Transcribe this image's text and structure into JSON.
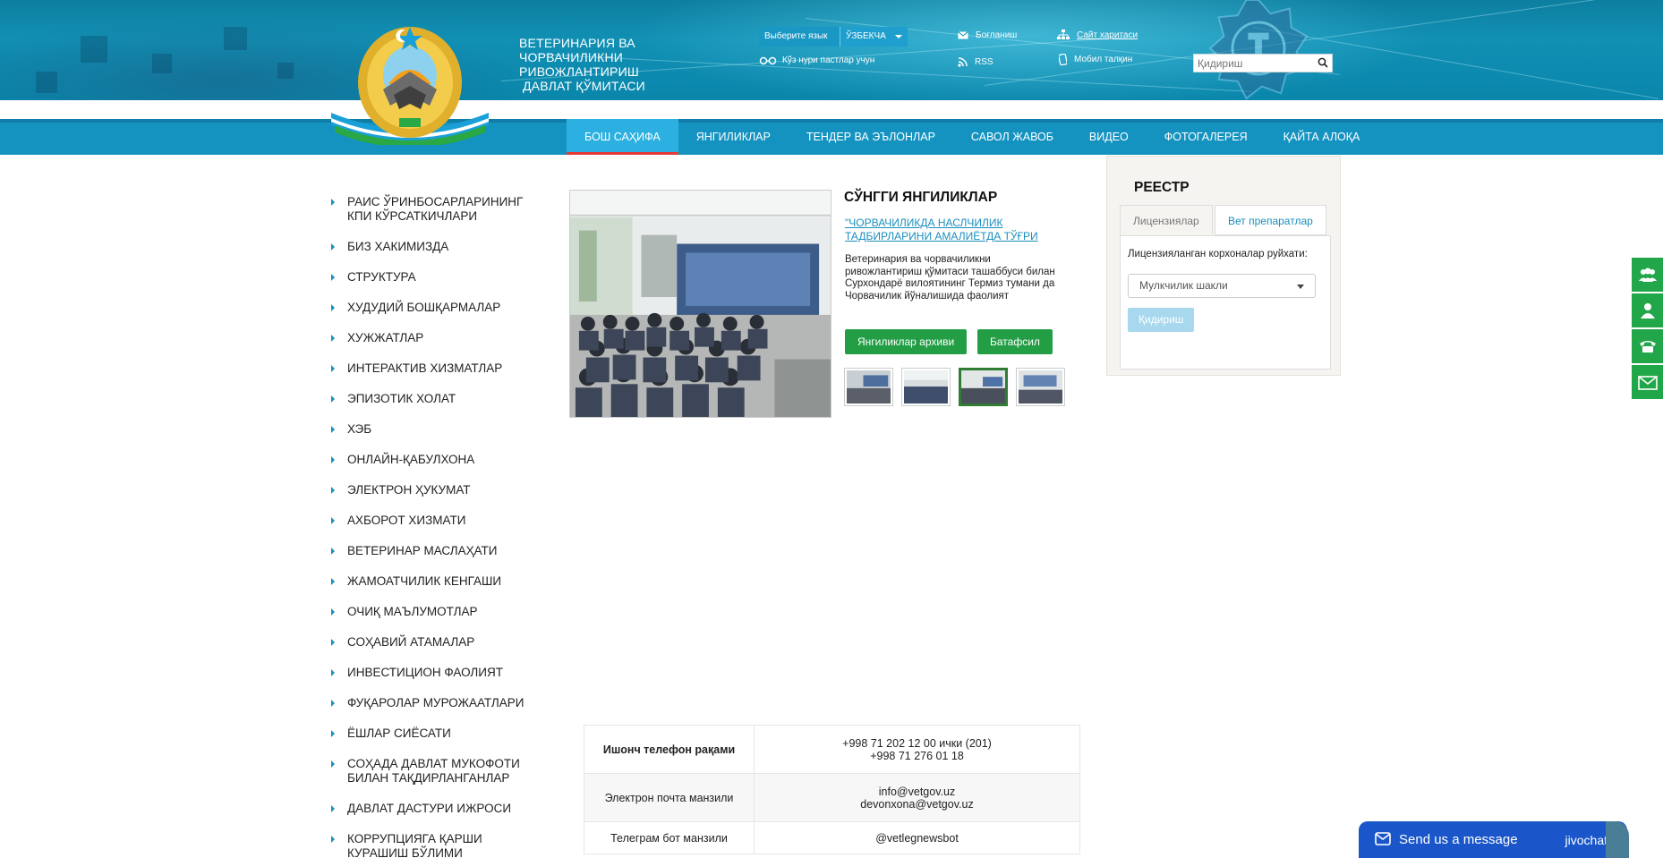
{
  "header": {
    "org_title_line1": "ВЕТЕРИНАРИЯ ВА",
    "org_title_line2": "ЧОРВАЧИЛИКНИ",
    "org_title_line3": "РИВОЖЛАНТИРИШ",
    "org_title_line4": "ДАВЛАТ ҚЎМИТАСИ",
    "lang_label": "Выберите язык",
    "lang_value": "ЎЗБЕКЧА",
    "vision_label": "Кўз нури пастлар учун",
    "contact_label": "Боғланиш",
    "rss_label": "RSS",
    "sitemap_label": "Сайт харитаси",
    "mobile_label": "Мобил талқин",
    "search_placeholder": "Қидириш"
  },
  "nav": {
    "items": [
      "БОШ САҲИФА",
      "ЯНГИЛИКЛАР",
      "ТЕНДЕР ВА ЭЪЛОНЛАР",
      "САВОЛ ЖАВОБ",
      "ВИДЕО",
      "ФОТОГАЛЕРЕЯ",
      "ҚАЙТА АЛОҚА"
    ],
    "active_index": 0
  },
  "sidebar": {
    "items": [
      "РАИС ЎРИНБОСАРЛАРИНИНГ КПИ КЎРСАТКИЧЛАРИ",
      "БИЗ ХАКИМИЗДА",
      "СТРУКТУРА",
      "ХУДУДИЙ БОШҚАРМАЛАР",
      "ХУЖЖАТЛАР",
      "ИНТЕРАКТИВ ХИЗМАТЛАР",
      "ЭПИЗОТИК ХОЛАТ",
      "ХЭБ",
      "ОНЛАЙН-ҚАБУЛХОНА",
      "ЭЛЕКТРОН ҲУКУМАТ",
      "АХБОРОТ ХИЗМАТИ",
      "ВЕТЕРИНАР МАСЛАҲАТИ",
      "ЖАМОАТЧИЛИК КЕНГАШИ",
      "ОЧИҚ МАЪЛУМОТЛАР",
      "СОҲАВИЙ АТАМАЛАР",
      "ИНВЕСТИЦИОН ФАОЛИЯТ",
      "ФУҚАРОЛАР МУРОЖААТЛАРИ",
      "ЁШЛАР СИЁСАТИ",
      "СОҲАДА ДАВЛАТ МУКОФОТИ БИЛАН ТАҚДИРЛАНГАНЛАР",
      "ДАВЛАТ ДАСТУРИ ИЖРОСИ",
      "КОРРУПЦИЯГА ҚАРШИ КУРАШИШ БЎЛИМИ"
    ]
  },
  "news": {
    "title": "СЎНГГИ ЯНГИЛИКЛАР",
    "link": "\"ЧОРВАЧИЛИКДА НАСЛЧИЛИК ТАДБИРЛАРИНИ АМАЛИЁТДА ТЎҒРИ",
    "text": "Ветеринария ва чорвачиликни ривожлантириш қўмитаси ташаббуси билан Сурхондарё вилоятининг Термиз тумани да Чорвачилик йўналишида фаолият",
    "archive_button": "Янгиликлар архиви",
    "more_button": "Батафсил",
    "selected_thumb": 2
  },
  "reestr": {
    "title": "РЕЕСТР",
    "tab1": "Лицензиялар",
    "tab2": "Вет препаратлар",
    "label": "Лицензияланган корхоналар руйхати:",
    "select_value": "Мулкчилик шакли",
    "search_button": "Қидириш"
  },
  "contacts": {
    "rows": [
      {
        "key": "Ишонч телефон рақами",
        "line1": "+998 71 202 12 00 ички (201)",
        "line2": "+998 71 276 01 18"
      },
      {
        "key": "Электрон почта манзили",
        "line1": "info@vetgov.uz",
        "line2": "devonxona@vetgov.uz"
      },
      {
        "key": "Телеграм бот манзили",
        "line1": "@vetlegnewsbot",
        "line2": ""
      }
    ]
  },
  "chat": {
    "label": "Send us a message",
    "brand": "jivochat"
  },
  "colors": {
    "header_blue": "#1190b4",
    "nav_blue": "#1593c0",
    "nav_active": "#2bb0e1",
    "nav_active_underline": "#e53935",
    "green_button": "#239e45",
    "chat_blue": "#1a56c9",
    "link_blue": "#1a8fbd"
  }
}
